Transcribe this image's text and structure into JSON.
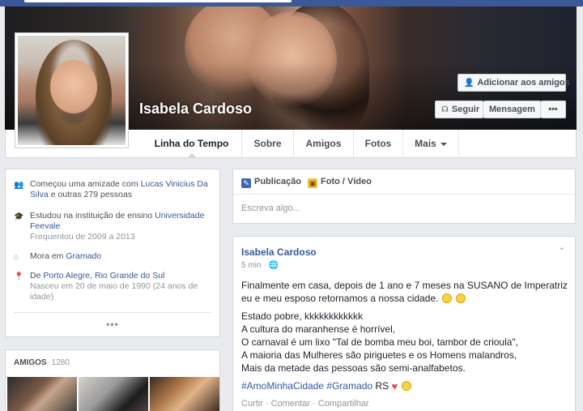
{
  "profile": {
    "name": "Isabela Cardoso",
    "add_friend_label": "Adicionar aos amigos",
    "follow_label": "Seguir",
    "message_label": "Mensagem",
    "more_label": "•••"
  },
  "tabs": [
    {
      "label": "Linha do Tempo"
    },
    {
      "label": "Sobre"
    },
    {
      "label": "Amigos"
    },
    {
      "label": "Fotos"
    },
    {
      "label": "Mais"
    }
  ],
  "intro": {
    "friendship": {
      "text": "Começou uma amizade com",
      "link": "Lucas Vinicius Da Silva",
      "rest": "e outras 279 pessoas"
    },
    "education": {
      "text": "Estudou na instituição de ensino",
      "link": "Universidade Feevale",
      "sub": "Frequentou de 2009 a 2013"
    },
    "lives": {
      "text": "Mora em",
      "link": "Gramado"
    },
    "origin": {
      "text": "De",
      "link": "Porto Alegre, Rio Grande do Sul",
      "sub": "Nasceu em 20 de maio de 1990 (24 anos de idade)"
    },
    "more": "•••"
  },
  "friends": {
    "label": "AMIGOS",
    "count": "· 1280"
  },
  "composer": {
    "publication_label": "Publicação",
    "photo_label": "Foto / Vídeo",
    "placeholder": "Escreva algo..."
  },
  "post": {
    "author": "Isabela Cardoso",
    "time": "5 min ·",
    "line1": "Finalmente em casa, depois de 1 ano e 7 meses na SUSANO de Imperatriz eu e meu esposo retornamos a nossa cidade.",
    "l2": "Estado pobre, kkkkkkkkkkkk",
    "l3": "A cultura do maranhense é horrível,",
    "l4": "O carnaval é um lixo \"Tal de bomba meu boi, tambor de crioula\",",
    "l5": "A maioria das Mulheres são piriguetes e os Homens malandros,",
    "l6": "Mais da metade das pessoas são semi-analfabetos.",
    "tag1": "#AmoMinhaCidade",
    "tag2": "#Gramado",
    "tag_rest": "RS",
    "like": "Curtir",
    "comment": "Comentar",
    "share": "Compartilhar"
  },
  "colors": {
    "brand": "#3b5998",
    "link": "#365899"
  }
}
